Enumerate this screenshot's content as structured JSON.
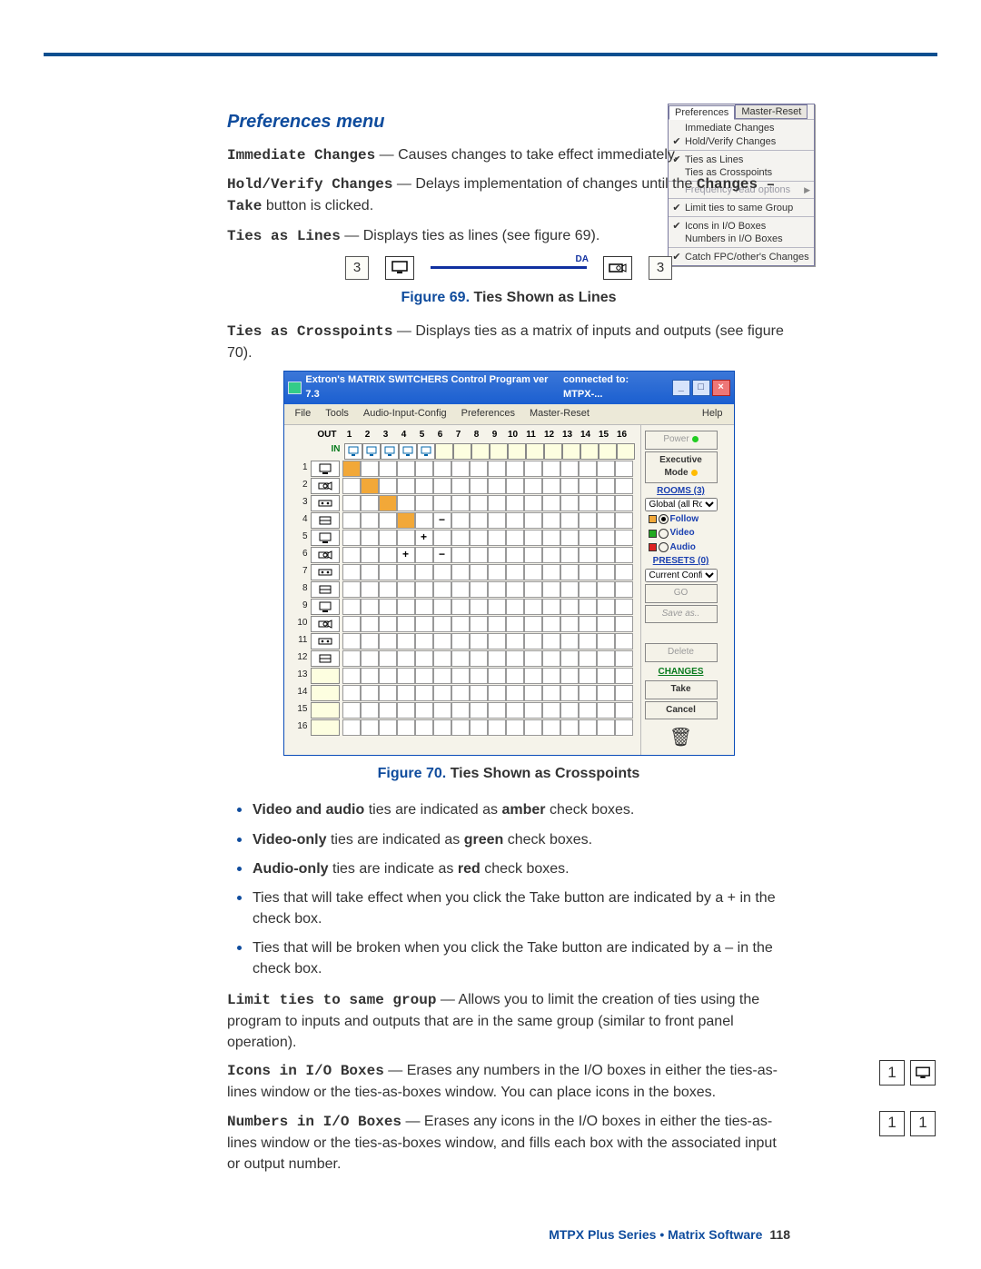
{
  "section_title": "Preferences menu",
  "items": {
    "immediate": {
      "label": "Immediate Changes",
      "desc": " — Causes changes to take effect immediately."
    },
    "hold": {
      "label": "Hold/Verify Changes",
      "desc": " — Delays implementation of changes until the ",
      "label2": "Changes – Take",
      "desc2": " button is clicked."
    },
    "ties_lines": {
      "label": "Ties as Lines",
      "desc": " — Displays ties as lines (see figure 69)."
    },
    "ties_cross": {
      "label": "Ties as Crosspoints",
      "desc": " — Displays ties as a matrix of inputs and outputs (see figure 70)."
    },
    "limit": {
      "label": "Limit ties to same group",
      "desc": " — Allows you to limit the creation of ties using the program to inputs and outputs that are in the same group (similar to front panel operation)."
    },
    "icons_io": {
      "label": "Icons in I/O Boxes",
      "desc": " — Erases any numbers in the I/O boxes in either the ties-as-lines window or the ties-as-boxes window. You can place icons in the boxes."
    },
    "numbers_io": {
      "label": "Numbers in I/O Boxes",
      "desc": " — Erases any icons in the I/O boxes in either the ties-as-lines window or the ties-as-boxes window, and fills each box with the associated input or output number."
    }
  },
  "fig69": {
    "num": "Figure 69.",
    "title": "Ties Shown as Lines",
    "left_box": "3",
    "right_box": "3",
    "da_label": "DA"
  },
  "fig70": {
    "num": "Figure 70.",
    "title": "Ties Shown as Crosspoints",
    "window_title": "Extron's MATRIX SWITCHERS Control Program    ver 7.3",
    "connected": "connected to:  MTPX-...",
    "menus": [
      "File",
      "Tools",
      "Audio-Input-Config",
      "Preferences",
      "Master-Reset",
      "Help"
    ],
    "out_label": "OUT",
    "in_label": "IN",
    "cols": 16,
    "rows": 16,
    "icon_cols": 5,
    "ties": {
      "amber": [
        [
          1,
          1
        ],
        [
          2,
          2
        ],
        [
          3,
          3
        ],
        [
          4,
          4
        ]
      ],
      "plus": [
        [
          5,
          5
        ],
        [
          6,
          4
        ]
      ],
      "minus": [
        [
          4,
          6
        ],
        [
          6,
          6
        ]
      ]
    },
    "side": {
      "power": "Power",
      "exec": "Executive Mode",
      "rooms": "ROOMS (3)",
      "global": "Global (all Room",
      "follow": "Follow",
      "video": "Video",
      "audio": "Audio",
      "presets": "PRESETS (0)",
      "current": "Current Config",
      "go": "GO",
      "saveas": "Save as..",
      "delete": "Delete",
      "changes": "CHANGES",
      "take": "Take",
      "cancel": "Cancel"
    }
  },
  "bullets": [
    {
      "bold1": "Video and audio",
      "mid": " ties are indicated as ",
      "bold2": "amber",
      "tail": " check boxes."
    },
    {
      "bold1": "Video-only",
      "mid": " ties are indicated as ",
      "bold2": "green",
      "tail": " check boxes."
    },
    {
      "bold1": "Audio-only",
      "mid": " ties are indicate as ",
      "bold2": "red",
      "tail": " check boxes."
    },
    {
      "plain": "Ties that will take effect when you click the Take button are indicated by a + in the check box."
    },
    {
      "plain": "Ties that will be broken when you click the Take button are indicated by a – in the check box."
    }
  ],
  "prefs_dropdown": {
    "tabs": [
      "Preferences",
      "Master-Reset"
    ],
    "groups": [
      [
        {
          "chk": "",
          "txt": "Immediate Changes"
        },
        {
          "chk": "✔",
          "txt": "Hold/Verify Changes"
        }
      ],
      [
        {
          "chk": "✔",
          "txt": "Ties as Lines"
        },
        {
          "chk": "",
          "txt": "Ties as Crosspoints"
        }
      ],
      [
        {
          "chk": "",
          "txt": "Frequency-read options",
          "dis": true,
          "arrow": true
        }
      ],
      [
        {
          "chk": "✔",
          "txt": "Limit ties to same Group"
        }
      ],
      [
        {
          "chk": "✔",
          "txt": "Icons in I/O Boxes"
        },
        {
          "chk": "",
          "txt": "Numbers in I/O Boxes"
        }
      ],
      [
        {
          "chk": "✔",
          "txt": "Catch FPC/other's Changes"
        }
      ]
    ]
  },
  "inline_boxes": {
    "icons_num": "1",
    "numbers_a": "1",
    "numbers_b": "1"
  },
  "footer": {
    "text": "MTPX Plus Series • Matrix Software",
    "page": "118"
  }
}
